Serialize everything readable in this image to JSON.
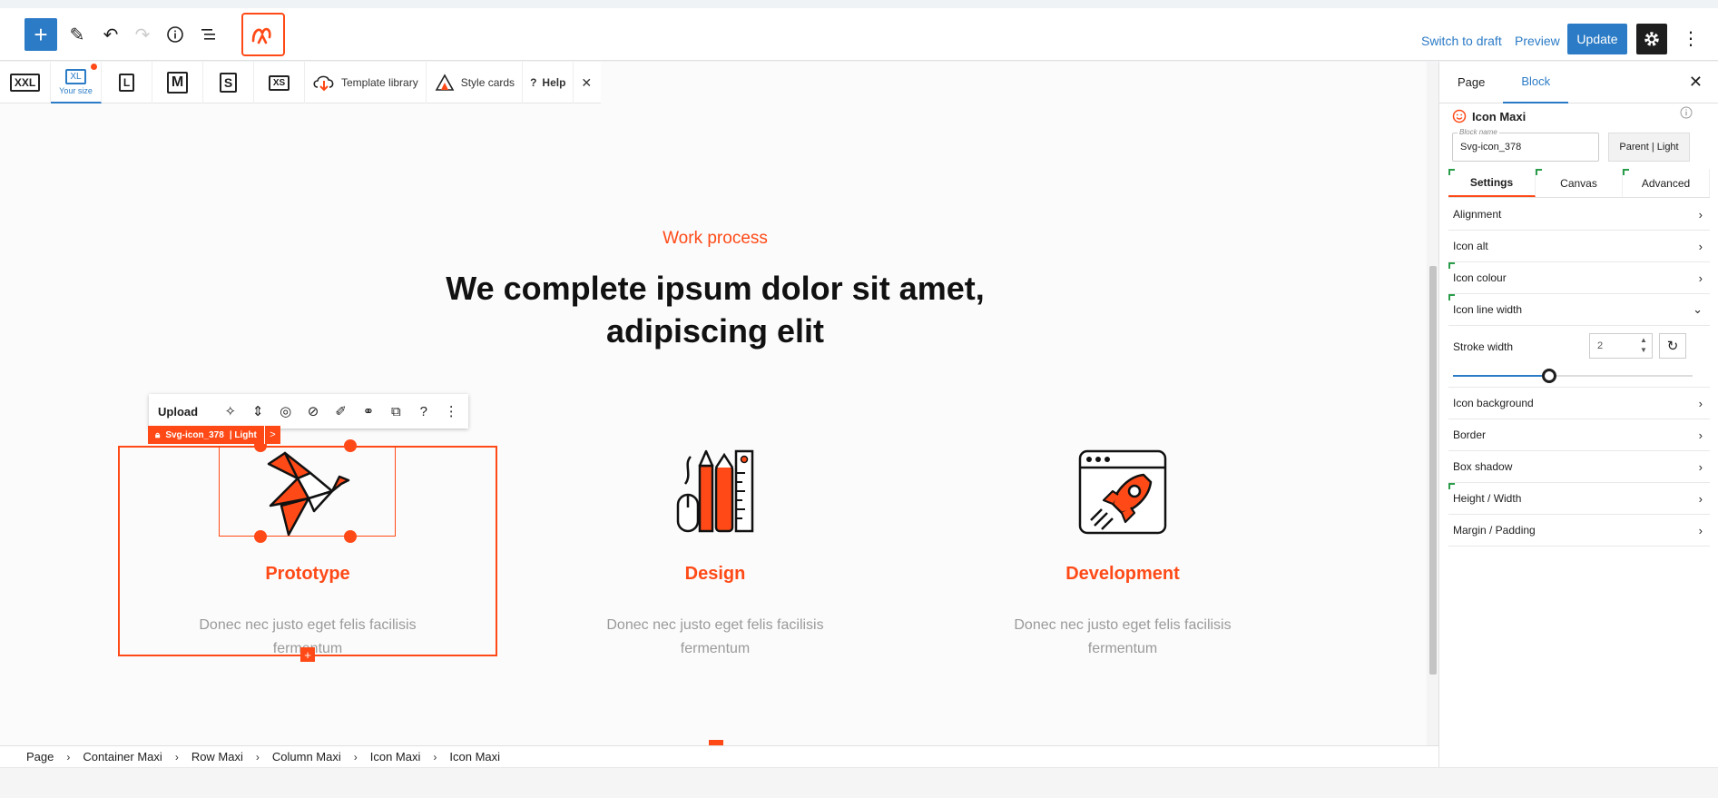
{
  "topbar": {
    "switch_draft": "Switch to draft",
    "preview": "Preview",
    "update": "Update",
    "icons": [
      "plus-icon",
      "pencil-icon",
      "undo-icon",
      "redo-icon",
      "info-icon",
      "list-view-icon",
      "maxi-logo-icon",
      "gear-icon",
      "more-vertical-icon"
    ]
  },
  "sizebar": {
    "sizes": [
      "XXL",
      "XL",
      "L",
      "M",
      "S",
      "XS"
    ],
    "your_size": "Your size",
    "template_library": "Template library",
    "style_cards": "Style cards",
    "help": "Help",
    "close": "✕"
  },
  "content": {
    "eyebrow": "Work process",
    "headline_line1": "We complete ipsum dolor sit amet,",
    "headline_line2": "adipiscing elit",
    "features": [
      {
        "title": "Prototype",
        "desc_line1": "Donec nec justo eget felis facilisis",
        "desc_line2": "fermentum"
      },
      {
        "title": "Design",
        "desc_line1": "Donec nec justo eget felis facilisis",
        "desc_line2": "fermentum"
      },
      {
        "title": "Development",
        "desc_line1": "Donec nec justo eget felis facilisis",
        "desc_line2": "fermentum"
      }
    ]
  },
  "block_toolbar": {
    "upload": "Upload",
    "tag_name": "Svg-icon_378",
    "tag_style": "| Light",
    "tag_arrow": ">"
  },
  "breadcrumb": [
    "Page",
    "Container Maxi",
    "Row Maxi",
    "Column Maxi",
    "Icon Maxi",
    "Icon Maxi"
  ],
  "inspector": {
    "tab_page": "Page",
    "tab_block": "Block",
    "block_title": "Icon Maxi",
    "block_name_label": "Block name",
    "block_name_value": "Svg-icon_378",
    "parent_btn": "Parent | Light",
    "settings_tabs": [
      "Settings",
      "Canvas",
      "Advanced"
    ],
    "panels_before": [
      "Alignment",
      "Icon alt",
      "Icon colour"
    ],
    "open_panel": "Icon line width",
    "stroke_label": "Stroke width",
    "stroke_value": "2",
    "panels_after": [
      "Icon background",
      "Border",
      "Box shadow",
      "Height / Width",
      "Margin / Padding"
    ]
  },
  "colors": {
    "accent": "#ff4a17",
    "wp_blue": "#2b7bc6"
  }
}
